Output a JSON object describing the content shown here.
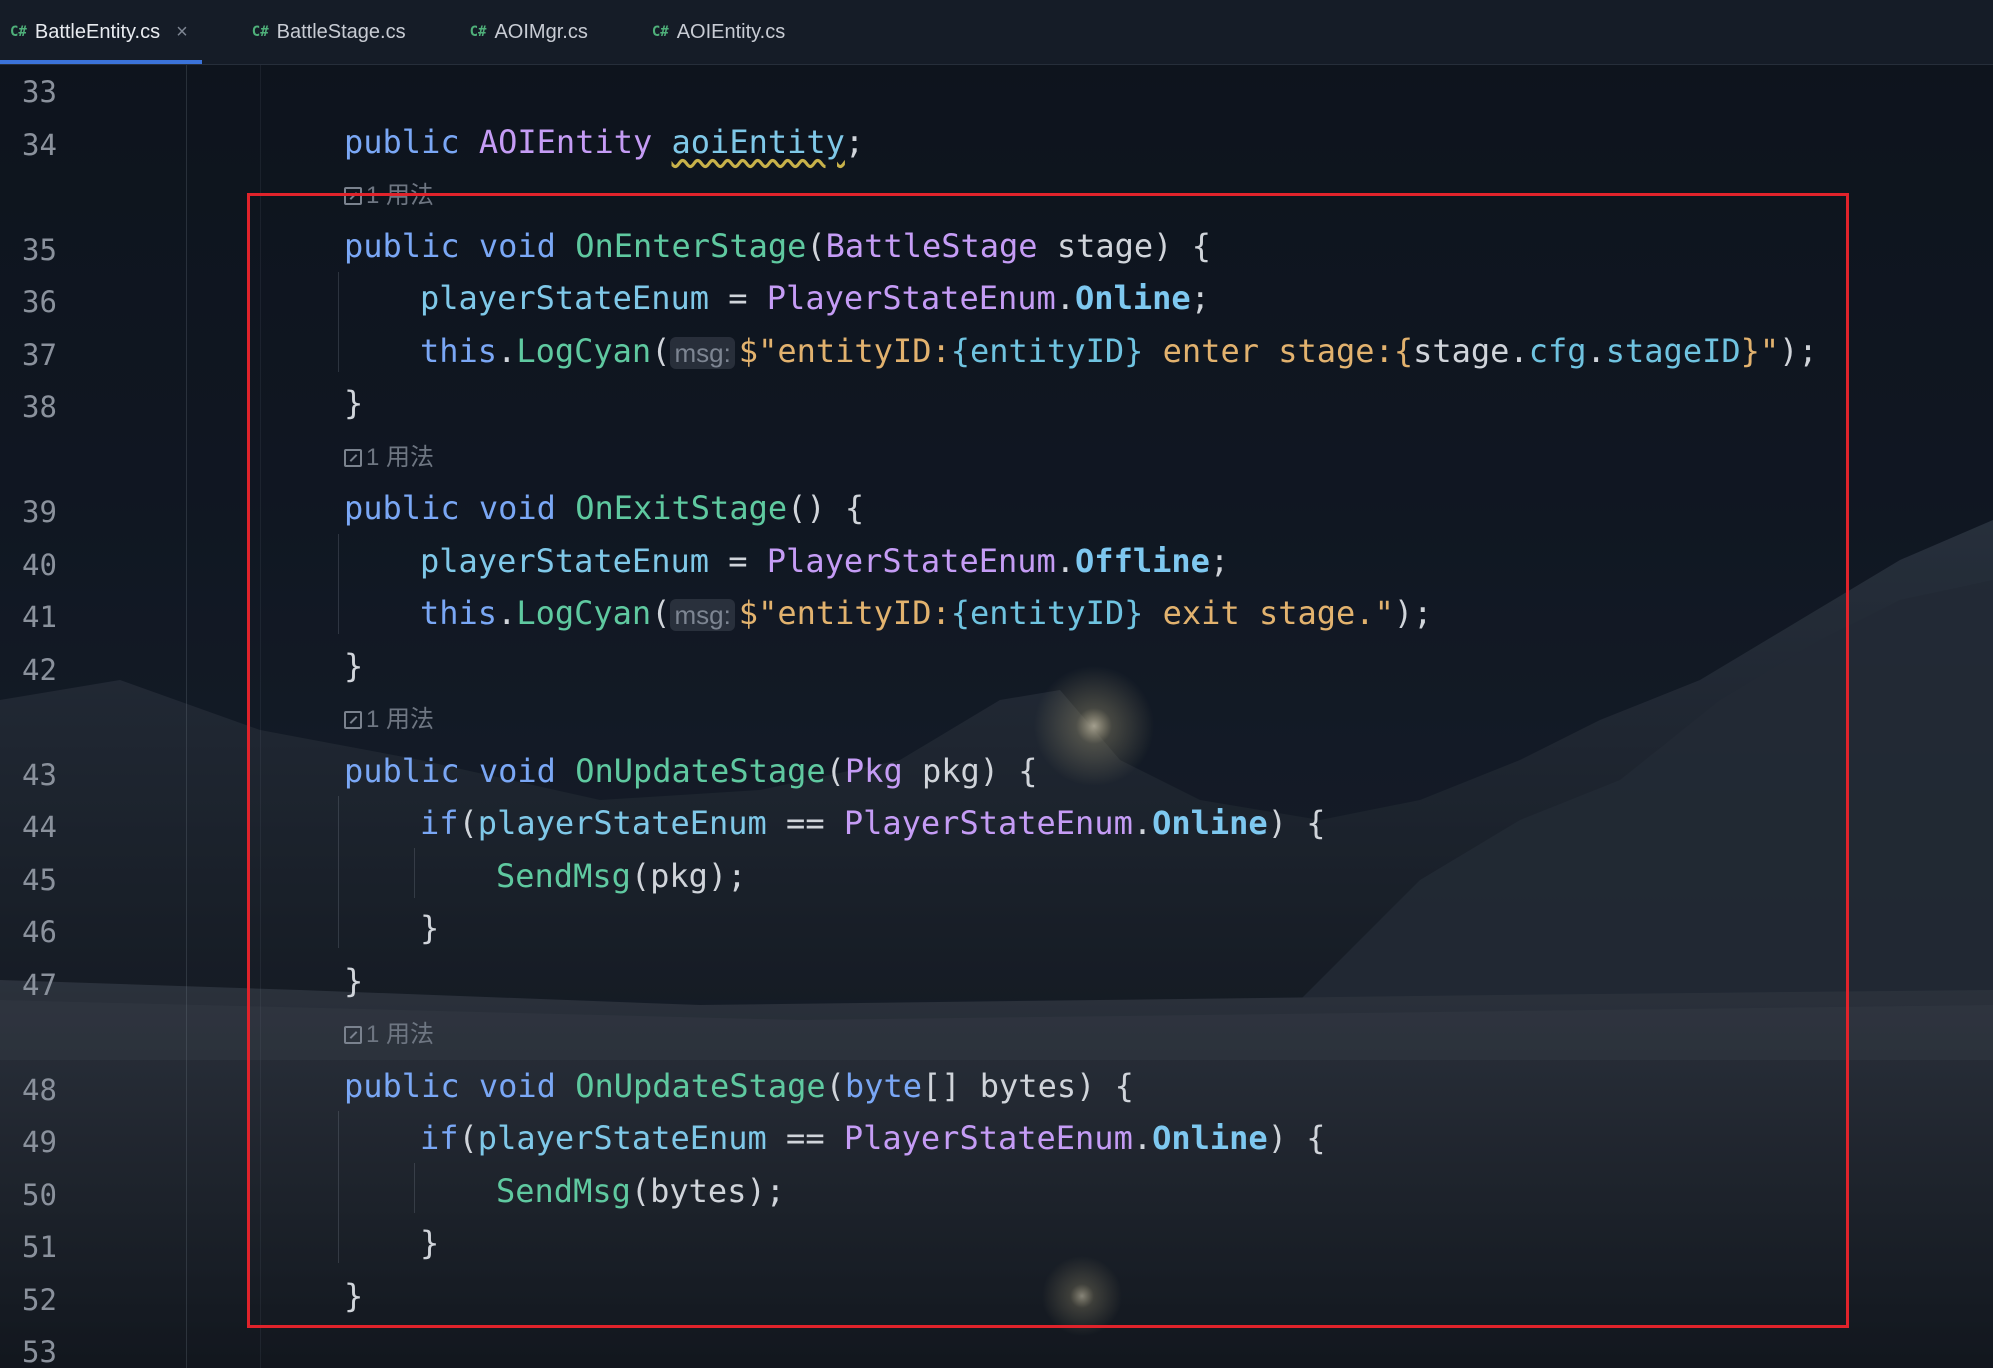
{
  "tabs": [
    {
      "lang": "C#",
      "label": "BattleEntity.cs",
      "active": true,
      "close": "×"
    },
    {
      "lang": "C#",
      "label": "BattleStage.cs",
      "active": false
    },
    {
      "lang": "C#",
      "label": "AOIMgr.cs",
      "active": false
    },
    {
      "lang": "C#",
      "label": "AOIEntity.cs",
      "active": false
    }
  ],
  "line_numbers": [
    "33",
    "34",
    "35",
    "36",
    "37",
    "38",
    "39",
    "40",
    "41",
    "42",
    "43",
    "44",
    "45",
    "46",
    "47",
    "48",
    "49",
    "50",
    "51",
    "52",
    "53"
  ],
  "usage_hint": "1 用法",
  "param_hint": "msg:",
  "code": {
    "l34": {
      "kw": "public",
      "type": "AOIEntity",
      "name": "aoiEntity",
      "end": ";"
    },
    "l35": {
      "kw1": "public",
      "kw2": "void",
      "fn": "OnEnterStage",
      "open": "(",
      "type": "BattleStage",
      "rest": " stage) {"
    },
    "l36": {
      "var": "playerStateEnum",
      "op": " = ",
      "type": "PlayerStateEnum",
      "dot": ".",
      "enum": "Online",
      "end": ";"
    },
    "l37": {
      "kw": "this",
      "dot": ".",
      "fn": "LogCyan",
      "open": "(",
      "s1": "$\"entityID:",
      "i1": "{entityID}",
      "s2": " enter stage:",
      "i2a": "{",
      "i2b": "stage",
      "i2c": ".",
      "i2d": "cfg",
      "i2e": ".",
      "i2f": "stageID",
      "i2g": "}",
      "s3": "\"",
      "end": ");"
    },
    "l38": "}",
    "l39": {
      "kw1": "public",
      "kw2": "void",
      "fn": "OnExitStage",
      "rest": "() {"
    },
    "l40": {
      "var": "playerStateEnum",
      "op": " = ",
      "type": "PlayerStateEnum",
      "dot": ".",
      "enum": "Offline",
      "end": ";"
    },
    "l41": {
      "kw": "this",
      "dot": ".",
      "fn": "LogCyan",
      "open": "(",
      "s1": "$\"entityID:",
      "i1": "{entityID}",
      "s2": " exit stage.\"",
      "end": ");"
    },
    "l42": "}",
    "l43": {
      "kw1": "public",
      "kw2": "void",
      "fn": "OnUpdateStage",
      "open": "(",
      "type": "Pkg",
      "rest": " pkg) {"
    },
    "l44": {
      "kw": "if",
      "open": "(",
      "var": "playerStateEnum",
      "op": " == ",
      "type": "PlayerStateEnum",
      "dot": ".",
      "enum": "Online",
      "end": ") {"
    },
    "l45": {
      "fn": "SendMsg",
      "rest": "(pkg);"
    },
    "l46": "}",
    "l47": "}",
    "l48": {
      "kw1": "public",
      "kw2": "void",
      "fn": "OnUpdateStage",
      "open": "(",
      "type": "byte",
      "rest": "[] bytes) {"
    },
    "l49": {
      "kw": "if",
      "open": "(",
      "var": "playerStateEnum",
      "op": " == ",
      "type": "PlayerStateEnum",
      "dot": ".",
      "enum": "Online",
      "end": ") {"
    },
    "l50": {
      "fn": "SendMsg",
      "rest": "(bytes);"
    },
    "l51": "}",
    "l52": "}"
  },
  "colors": {
    "keyword": "#7aa7f5",
    "type": "#c59cf5",
    "function": "#5fc9a0",
    "string": "#e2b26e",
    "enum_value": "#7ec8f0",
    "highlight_box": "#e0232b",
    "active_tab_indicator": "#3b73d9"
  },
  "icons": [
    "csharp-file-icon",
    "close-tab-icon",
    "usages-icon"
  ]
}
